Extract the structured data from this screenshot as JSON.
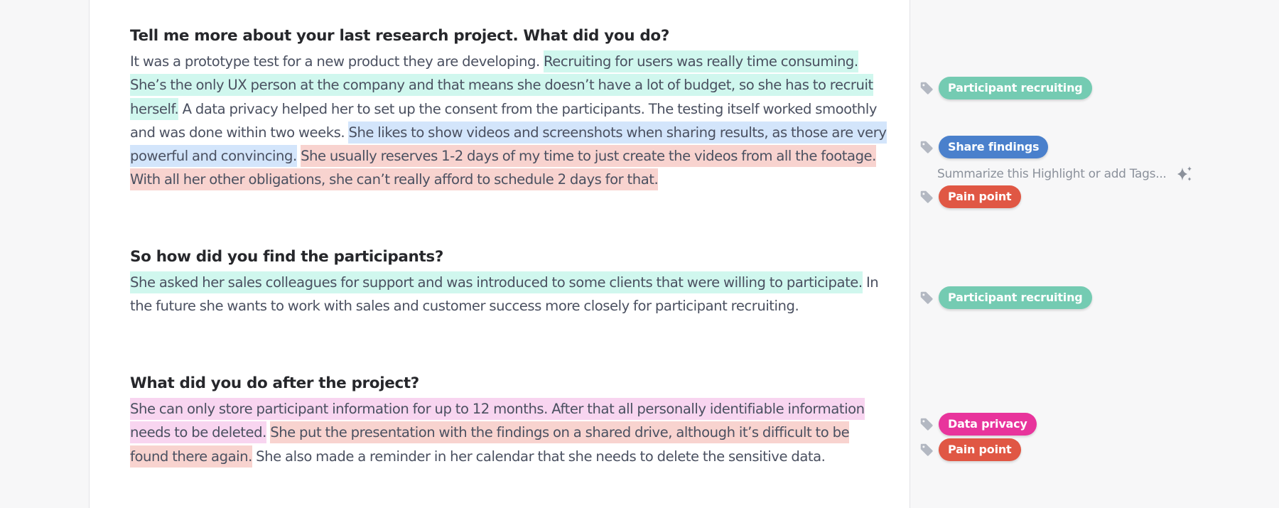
{
  "transcript": [
    {
      "question": "Tell me more about your last research project. What did you do?",
      "segments": [
        {
          "text": "It was a prototype test for a new product they are developing. ",
          "highlight": "none"
        },
        {
          "text": "Recruiting for users was really time consuming. She’s the only UX person at the company and that means she doesn’t have a lot of budget, so she has to recruit herself.",
          "highlight": "green"
        },
        {
          "text": " A data privacy helped her to set up the consent from the participants. The testing itself worked smoothly and was done within two weeks. ",
          "highlight": "none"
        },
        {
          "text": "She likes to show videos and screenshots when sharing results, as those are very powerful and convincing.",
          "highlight": "blue"
        },
        {
          "text": " ",
          "highlight": "none"
        },
        {
          "text": "She usually reserves 1-2 days of my time to just create the videos from all the footage. With all her other obligations, she can’t really afford to schedule 2 days for that.",
          "highlight": "red"
        }
      ]
    },
    {
      "question": "So how did you find the participants?",
      "segments": [
        {
          "text": "She asked her sales colleagues for support and was introduced to some clients that were willing to participate.",
          "highlight": "green"
        },
        {
          "text": " In the future she wants to work with sales and customer success more closely for participant recruiting.",
          "highlight": "none"
        }
      ]
    },
    {
      "question": "What did you do after the project?",
      "segments": [
        {
          "text": "She can only store participant information for up to 12 months. After that all personally identifiable information needs to be deleted.",
          "highlight": "pink"
        },
        {
          "text": " ",
          "highlight": "none"
        },
        {
          "text": "She put the presentation with the findings on a shared drive, although it’s difficult to be found there again.",
          "highlight": "red"
        },
        {
          "text": " She also made a reminder in her calendar that she needs to delete the sensitive data.",
          "highlight": "none"
        }
      ]
    }
  ],
  "tags": [
    {
      "label": "Participant recruiting",
      "color": "#74cbb2",
      "icon": "tag-icon"
    },
    {
      "label": "Share findings",
      "color": "#4a80cc",
      "icon": "tag-icon"
    },
    {
      "label": "Pain point",
      "color": "#e05744",
      "icon": "tag-icon"
    },
    {
      "label": "Participant recruiting",
      "color": "#74cbb2",
      "icon": "tag-icon"
    },
    {
      "label": "Data privacy",
      "color": "#e8349c",
      "icon": "tag-icon"
    },
    {
      "label": "Pain point",
      "color": "#e05744",
      "icon": "tag-icon"
    }
  ],
  "summarize_prompt": {
    "placeholder": "Summarize this Highlight or add Tags...",
    "icon": "sparkle-icon"
  },
  "colors": {
    "highlight_green": "#d0f7ee",
    "highlight_blue": "#d3e5fb",
    "highlight_red": "#f8d3cf",
    "highlight_pink": "#f8d5f0"
  }
}
